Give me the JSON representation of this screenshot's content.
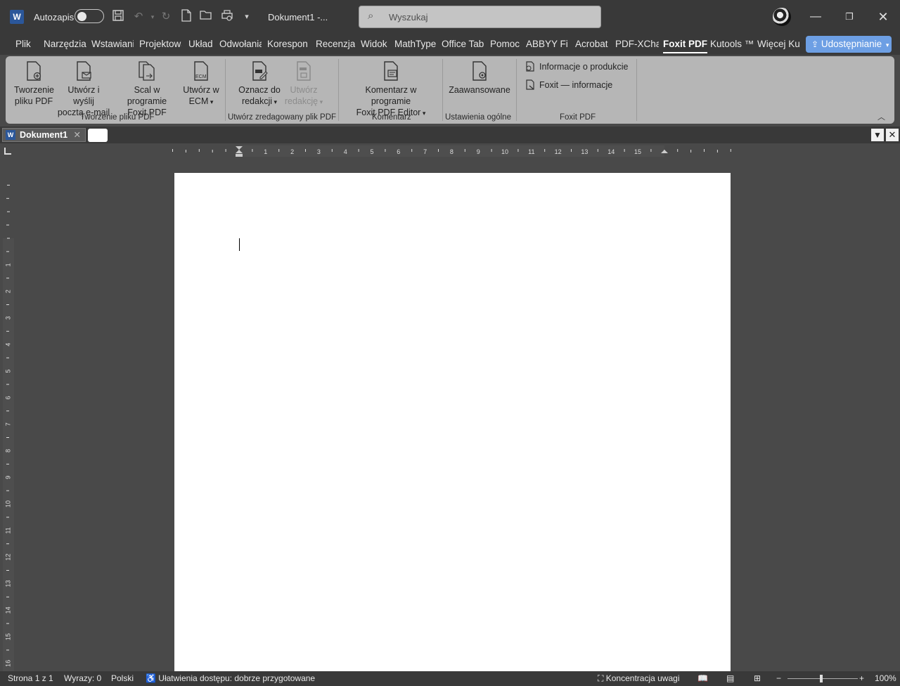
{
  "titlebar": {
    "autosave_label": "Autozapis",
    "doc_title": "Dokument1  -...",
    "search_placeholder": "Wyszukaj"
  },
  "tabs": [
    {
      "label": "Plik"
    },
    {
      "label": "Narzędzia"
    },
    {
      "label": "Wstawiani"
    },
    {
      "label": "Projektowa"
    },
    {
      "label": "Układ"
    },
    {
      "label": "Odwołania"
    },
    {
      "label": "Korespon"
    },
    {
      "label": "Recenzja"
    },
    {
      "label": "Widok"
    },
    {
      "label": "MathType"
    },
    {
      "label": "Office Tab"
    },
    {
      "label": "Pomoc"
    },
    {
      "label": "ABBYY Fine"
    },
    {
      "label": "Acrobat"
    },
    {
      "label": "PDF-XChar"
    },
    {
      "label": "Foxit PDF"
    },
    {
      "label": "Kutools ™"
    },
    {
      "label": "Więcej Ku"
    }
  ],
  "share_label": "Udostępnianie",
  "ribbon": {
    "create_pdf": "Tworzenie pliku PDF",
    "create_pdf_l1": "Tworzenie",
    "create_pdf_l2": "pliku PDF",
    "email_l1": "Utwórz i wyślij",
    "email_l2": "pocztą e-mail",
    "merge_l1": "Scal w programie",
    "merge_l2": "Foxit PDF",
    "ecm_l1": "Utwórz w",
    "ecm_l2": "ECM",
    "group1": "Tworzenie pliku PDF",
    "mark_l1": "Oznacz do",
    "mark_l2": "redakcji",
    "redact_l1": "Utwórz",
    "redact_l2": "redakcję",
    "group2": "Utwórz zredagowany plik PDF",
    "comment_l1": "Komentarz w programie",
    "comment_l2": "Foxit PDF Editor",
    "group3": "Komentarz",
    "advanced": "Zaawansowane",
    "group4": "Ustawienia ogólne",
    "product_info": "Informacje o produkcie",
    "about_foxit": "Foxit — informacje",
    "group5": "Foxit PDF",
    "ecm_icon_text": "ECM"
  },
  "doctab": {
    "label": "Dokument1"
  },
  "ruler_numbers": [
    "1",
    "2",
    "3",
    "4",
    "5",
    "6",
    "7",
    "8",
    "9",
    "10",
    "11",
    "12",
    "13",
    "14",
    "15"
  ],
  "vruler_numbers": [
    "1",
    "2",
    "3",
    "4",
    "5",
    "6",
    "7",
    "8",
    "9",
    "10",
    "11",
    "12",
    "13",
    "14",
    "15",
    "16"
  ],
  "status": {
    "page": "Strona 1 z 1",
    "words": "Wyrazy: 0",
    "language": "Polski",
    "accessibility": "Ułatwienia dostępu: dobrze przygotowane",
    "focus": "Koncentracja uwagi",
    "zoom": "100%"
  },
  "icons": {
    "word": "W"
  }
}
